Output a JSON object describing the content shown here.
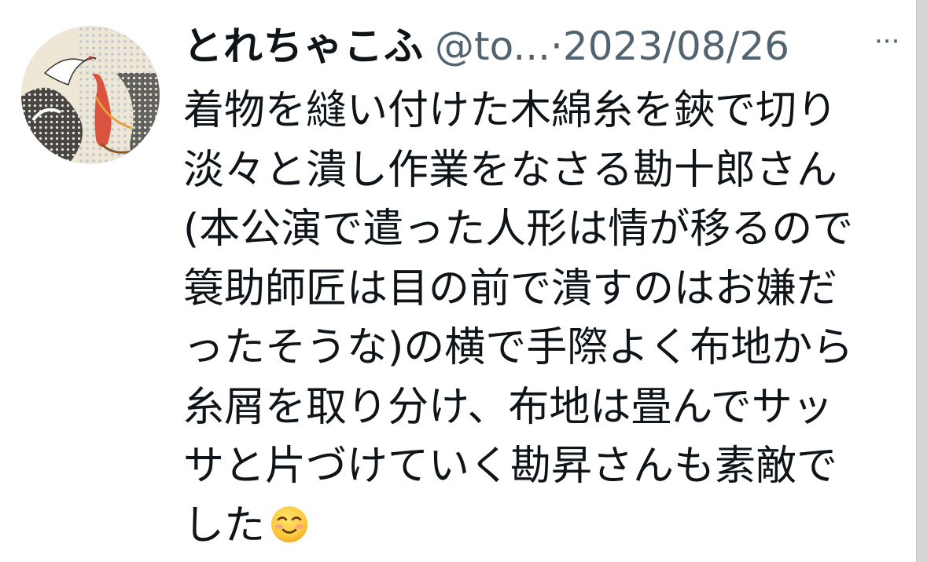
{
  "tweet": {
    "avatar_icon": "kimono-crane-avatar-icon",
    "display_name": "とれちゃこふ",
    "handle": "@to...",
    "separator": "·",
    "date": "2023/08/26",
    "more_icon": "more-options-icon",
    "more_label": "···",
    "lines": [
      "着物を縫い付けた木綿糸を鋏で切り",
      "淡々と潰し作業をなさる勘十郎さん",
      "(本公演で遣った人形は情が移るので",
      "簑助師匠は目の前で潰すのはお嫌だ",
      "ったそうな)の横で手際よく布地から",
      "糸屑を取り分け、布地は畳んでサッ",
      "サと片づけていく勘昇さんも素敵で",
      "した"
    ],
    "emoji": "smiling-face-emoji"
  },
  "colors": {
    "text": "#0f1419",
    "secondary": "#536471",
    "background": "#ffffff"
  }
}
